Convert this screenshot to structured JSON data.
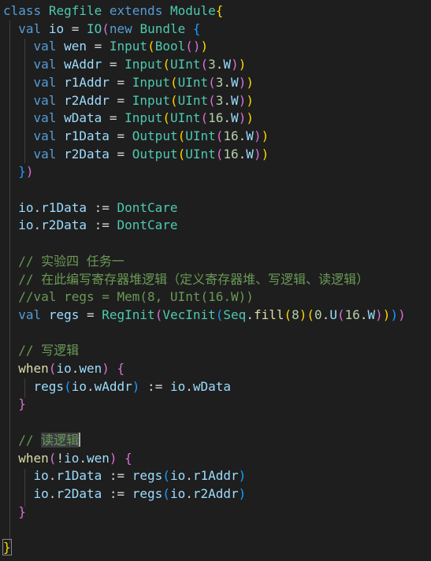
{
  "colors": {
    "background": "#1e1e1e",
    "keyword": "#569cd6",
    "class_name": "#4ec9b0",
    "identifier": "#9cdcfe",
    "function": "#dcdcaa",
    "number": "#b5cea8",
    "comment": "#6a9955",
    "plain": "#d4d4d4",
    "bracket1": "#ffd700",
    "bracket2": "#da70d6",
    "bracket3": "#179fff",
    "control": "#c586c0"
  },
  "lines": [
    {
      "tokens": [
        [
          "class",
          "keyword"
        ],
        [
          " ",
          "plain"
        ],
        [
          "Regfile",
          "class_name"
        ],
        [
          " ",
          "plain"
        ],
        [
          "extends",
          "keyword"
        ],
        [
          " ",
          "plain"
        ],
        [
          "Module",
          "class_name"
        ],
        [
          "{",
          "bracket1"
        ]
      ]
    },
    {
      "tokens": [
        [
          "  ",
          "plain"
        ],
        [
          "val",
          "keyword"
        ],
        [
          " ",
          "plain"
        ],
        [
          "io",
          "identifier"
        ],
        [
          " = ",
          "plain"
        ],
        [
          "IO",
          "class_name"
        ],
        [
          "(",
          "bracket2"
        ],
        [
          "new",
          "keyword"
        ],
        [
          " ",
          "plain"
        ],
        [
          "Bundle",
          "class_name"
        ],
        [
          " ",
          "plain"
        ],
        [
          "{",
          "bracket3"
        ]
      ]
    },
    {
      "tokens": [
        [
          "    ",
          "plain"
        ],
        [
          "val",
          "keyword"
        ],
        [
          " ",
          "plain"
        ],
        [
          "wen",
          "identifier"
        ],
        [
          " = ",
          "plain"
        ],
        [
          "Input",
          "class_name"
        ],
        [
          "(",
          "bracket1"
        ],
        [
          "Bool",
          "class_name"
        ],
        [
          "()",
          "bracket2"
        ],
        [
          ")",
          "bracket1"
        ]
      ]
    },
    {
      "tokens": [
        [
          "    ",
          "plain"
        ],
        [
          "val",
          "keyword"
        ],
        [
          " ",
          "plain"
        ],
        [
          "wAddr",
          "identifier"
        ],
        [
          " = ",
          "plain"
        ],
        [
          "Input",
          "class_name"
        ],
        [
          "(",
          "bracket1"
        ],
        [
          "UInt",
          "class_name"
        ],
        [
          "(",
          "bracket2"
        ],
        [
          "3",
          "number"
        ],
        [
          ".",
          "plain"
        ],
        [
          "W",
          "identifier"
        ],
        [
          ")",
          "bracket2"
        ],
        [
          ")",
          "bracket1"
        ]
      ]
    },
    {
      "tokens": [
        [
          "    ",
          "plain"
        ],
        [
          "val",
          "keyword"
        ],
        [
          " ",
          "plain"
        ],
        [
          "r1Addr",
          "identifier"
        ],
        [
          " = ",
          "plain"
        ],
        [
          "Input",
          "class_name"
        ],
        [
          "(",
          "bracket1"
        ],
        [
          "UInt",
          "class_name"
        ],
        [
          "(",
          "bracket2"
        ],
        [
          "3",
          "number"
        ],
        [
          ".",
          "plain"
        ],
        [
          "W",
          "identifier"
        ],
        [
          ")",
          "bracket2"
        ],
        [
          ")",
          "bracket1"
        ]
      ]
    },
    {
      "tokens": [
        [
          "    ",
          "plain"
        ],
        [
          "val",
          "keyword"
        ],
        [
          " ",
          "plain"
        ],
        [
          "r2Addr",
          "identifier"
        ],
        [
          " = ",
          "plain"
        ],
        [
          "Input",
          "class_name"
        ],
        [
          "(",
          "bracket1"
        ],
        [
          "UInt",
          "class_name"
        ],
        [
          "(",
          "bracket2"
        ],
        [
          "3",
          "number"
        ],
        [
          ".",
          "plain"
        ],
        [
          "W",
          "identifier"
        ],
        [
          ")",
          "bracket2"
        ],
        [
          ")",
          "bracket1"
        ]
      ]
    },
    {
      "tokens": [
        [
          "    ",
          "plain"
        ],
        [
          "val",
          "keyword"
        ],
        [
          " ",
          "plain"
        ],
        [
          "wData",
          "identifier"
        ],
        [
          " = ",
          "plain"
        ],
        [
          "Input",
          "class_name"
        ],
        [
          "(",
          "bracket1"
        ],
        [
          "UInt",
          "class_name"
        ],
        [
          "(",
          "bracket2"
        ],
        [
          "16",
          "number"
        ],
        [
          ".",
          "plain"
        ],
        [
          "W",
          "identifier"
        ],
        [
          ")",
          "bracket2"
        ],
        [
          ")",
          "bracket1"
        ]
      ]
    },
    {
      "tokens": [
        [
          "    ",
          "plain"
        ],
        [
          "val",
          "keyword"
        ],
        [
          " ",
          "plain"
        ],
        [
          "r1Data",
          "identifier"
        ],
        [
          " = ",
          "plain"
        ],
        [
          "Output",
          "class_name"
        ],
        [
          "(",
          "bracket1"
        ],
        [
          "UInt",
          "class_name"
        ],
        [
          "(",
          "bracket2"
        ],
        [
          "16",
          "number"
        ],
        [
          ".",
          "plain"
        ],
        [
          "W",
          "identifier"
        ],
        [
          ")",
          "bracket2"
        ],
        [
          ")",
          "bracket1"
        ]
      ]
    },
    {
      "tokens": [
        [
          "    ",
          "plain"
        ],
        [
          "val",
          "keyword"
        ],
        [
          " ",
          "plain"
        ],
        [
          "r2Data",
          "identifier"
        ],
        [
          " = ",
          "plain"
        ],
        [
          "Output",
          "class_name"
        ],
        [
          "(",
          "bracket1"
        ],
        [
          "UInt",
          "class_name"
        ],
        [
          "(",
          "bracket2"
        ],
        [
          "16",
          "number"
        ],
        [
          ".",
          "plain"
        ],
        [
          "W",
          "identifier"
        ],
        [
          ")",
          "bracket2"
        ],
        [
          ")",
          "bracket1"
        ]
      ]
    },
    {
      "tokens": [
        [
          "  ",
          "plain"
        ],
        [
          "}",
          "bracket3"
        ],
        [
          ")",
          "bracket2"
        ]
      ]
    },
    {
      "tokens": []
    },
    {
      "tokens": [
        [
          "  ",
          "plain"
        ],
        [
          "io",
          "identifier"
        ],
        [
          ".",
          "plain"
        ],
        [
          "r1Data",
          "identifier"
        ],
        [
          " := ",
          "plain"
        ],
        [
          "DontCare",
          "class_name"
        ]
      ]
    },
    {
      "tokens": [
        [
          "  ",
          "plain"
        ],
        [
          "io",
          "identifier"
        ],
        [
          ".",
          "plain"
        ],
        [
          "r2Data",
          "identifier"
        ],
        [
          " := ",
          "plain"
        ],
        [
          "DontCare",
          "class_name"
        ]
      ]
    },
    {
      "tokens": []
    },
    {
      "tokens": [
        [
          "  ",
          "plain"
        ],
        [
          "// 实验四 任务一",
          "comment"
        ]
      ]
    },
    {
      "tokens": [
        [
          "  ",
          "plain"
        ],
        [
          "// 在此编写寄存器堆逻辑（定义寄存器堆、写逻辑、读逻辑）",
          "comment"
        ]
      ]
    },
    {
      "tokens": [
        [
          "  ",
          "plain"
        ],
        [
          "//val regs = Mem(8, UInt(16.W))",
          "comment"
        ]
      ]
    },
    {
      "tokens": [
        [
          "  ",
          "plain"
        ],
        [
          "val",
          "keyword"
        ],
        [
          " ",
          "plain"
        ],
        [
          "regs",
          "identifier"
        ],
        [
          " = ",
          "plain"
        ],
        [
          "RegInit",
          "class_name"
        ],
        [
          "(",
          "bracket2"
        ],
        [
          "VecInit",
          "class_name"
        ],
        [
          "(",
          "bracket3"
        ],
        [
          "Seq",
          "class_name"
        ],
        [
          ".",
          "plain"
        ],
        [
          "fill",
          "function"
        ],
        [
          "(",
          "bracket1"
        ],
        [
          "8",
          "number"
        ],
        [
          ")",
          "bracket1"
        ],
        [
          "(",
          "bracket1"
        ],
        [
          "0",
          "number"
        ],
        [
          ".",
          "plain"
        ],
        [
          "U",
          "identifier"
        ],
        [
          "(",
          "bracket2"
        ],
        [
          "16",
          "number"
        ],
        [
          ".",
          "plain"
        ],
        [
          "W",
          "identifier"
        ],
        [
          ")",
          "bracket2"
        ],
        [
          ")",
          "bracket1"
        ],
        [
          ")",
          "bracket3"
        ],
        [
          ")",
          "bracket2"
        ]
      ]
    },
    {
      "tokens": []
    },
    {
      "tokens": [
        [
          "  ",
          "plain"
        ],
        [
          "// 写逻辑",
          "comment"
        ]
      ]
    },
    {
      "tokens": [
        [
          "  ",
          "plain"
        ],
        [
          "when",
          "function"
        ],
        [
          "(",
          "bracket2"
        ],
        [
          "io",
          "identifier"
        ],
        [
          ".",
          "plain"
        ],
        [
          "wen",
          "identifier"
        ],
        [
          ")",
          "bracket2"
        ],
        [
          " ",
          "plain"
        ],
        [
          "{",
          "bracket2"
        ]
      ]
    },
    {
      "tokens": [
        [
          "    ",
          "plain"
        ],
        [
          "regs",
          "identifier"
        ],
        [
          "(",
          "bracket3"
        ],
        [
          "io",
          "identifier"
        ],
        [
          ".",
          "plain"
        ],
        [
          "wAddr",
          "identifier"
        ],
        [
          ")",
          "bracket3"
        ],
        [
          " := ",
          "plain"
        ],
        [
          "io",
          "identifier"
        ],
        [
          ".",
          "plain"
        ],
        [
          "wData",
          "identifier"
        ]
      ]
    },
    {
      "tokens": [
        [
          "  ",
          "plain"
        ],
        [
          "}",
          "bracket2"
        ]
      ]
    },
    {
      "tokens": []
    },
    {
      "tokens": [
        [
          "  ",
          "plain"
        ],
        [
          "// ",
          "comment"
        ],
        [
          "读逻辑",
          "comment_hl"
        ],
        [
          "|caret",
          "caret"
        ]
      ]
    },
    {
      "tokens": [
        [
          "  ",
          "plain"
        ],
        [
          "when",
          "function"
        ],
        [
          "(",
          "bracket2"
        ],
        [
          "!",
          "plain"
        ],
        [
          "io",
          "identifier"
        ],
        [
          ".",
          "plain"
        ],
        [
          "wen",
          "identifier"
        ],
        [
          ")",
          "bracket2"
        ],
        [
          " ",
          "plain"
        ],
        [
          "{",
          "bracket2"
        ]
      ]
    },
    {
      "tokens": [
        [
          "    ",
          "plain"
        ],
        [
          "io",
          "identifier"
        ],
        [
          ".",
          "plain"
        ],
        [
          "r1Data",
          "identifier"
        ],
        [
          " := ",
          "plain"
        ],
        [
          "regs",
          "identifier"
        ],
        [
          "(",
          "bracket3"
        ],
        [
          "io",
          "identifier"
        ],
        [
          ".",
          "plain"
        ],
        [
          "r1Addr",
          "identifier"
        ],
        [
          ")",
          "bracket3"
        ]
      ]
    },
    {
      "tokens": [
        [
          "    ",
          "plain"
        ],
        [
          "io",
          "identifier"
        ],
        [
          ".",
          "plain"
        ],
        [
          "r2Data",
          "identifier"
        ],
        [
          " := ",
          "plain"
        ],
        [
          "regs",
          "identifier"
        ],
        [
          "(",
          "bracket3"
        ],
        [
          "io",
          "identifier"
        ],
        [
          ".",
          "plain"
        ],
        [
          "r2Addr",
          "identifier"
        ],
        [
          ")",
          "bracket3"
        ]
      ]
    },
    {
      "tokens": [
        [
          "  ",
          "plain"
        ],
        [
          "}",
          "bracket2"
        ]
      ]
    },
    {
      "tokens": []
    },
    {
      "tokens": [
        [
          "}",
          "bracket1_box"
        ]
      ]
    }
  ]
}
